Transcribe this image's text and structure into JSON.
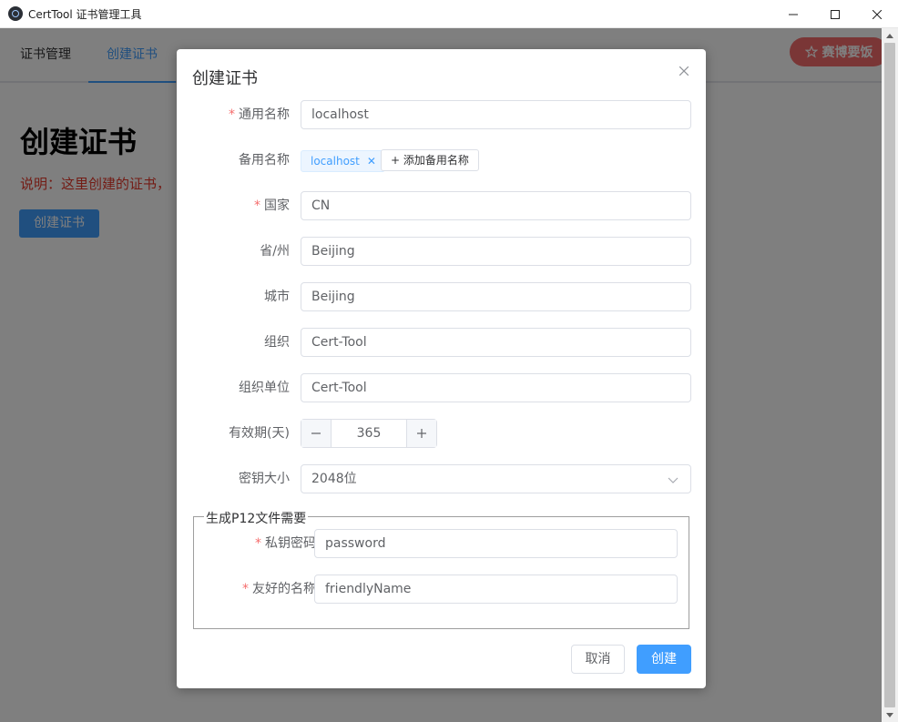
{
  "window": {
    "title": "CertTool 证书管理工具",
    "controls": [
      "minimize",
      "maximize",
      "close"
    ]
  },
  "tabs": [
    {
      "label": "证书管理",
      "active": false
    },
    {
      "label": "创建证书",
      "active": true
    }
  ],
  "sponsor_label": "赛博要饭",
  "page": {
    "heading": "创建证书",
    "description": "说明：这里创建的证书，",
    "create_button": "创建证书"
  },
  "dialog": {
    "title": "创建证书",
    "fields": {
      "common_name": {
        "label": "通用名称",
        "required": true,
        "value": "localhost"
      },
      "alt_names": {
        "label": "备用名称",
        "tags": [
          "localhost"
        ],
        "add_label": "+ 添加备用名称"
      },
      "country": {
        "label": "国家",
        "required": true,
        "value": "CN"
      },
      "province": {
        "label": "省/州",
        "value": "Beijing"
      },
      "city": {
        "label": "城市",
        "value": "Beijing"
      },
      "org": {
        "label": "组织",
        "value": "Cert-Tool"
      },
      "org_unit": {
        "label": "组织单位",
        "value": "Cert-Tool"
      },
      "validity": {
        "label": "有效期(天)",
        "value": "365"
      },
      "key_size": {
        "label": "密钥大小",
        "value": "2048位"
      }
    },
    "p12": {
      "legend": "生成P12文件需要",
      "password": {
        "label": "私钥密码",
        "required": true,
        "value": "password"
      },
      "friendly_name": {
        "label": "友好的名称",
        "required": true,
        "value": "friendlyName"
      }
    },
    "cancel_label": "取消",
    "ok_label": "创建"
  },
  "colors": {
    "primary": "#409eff",
    "danger": "#f56c6c",
    "text": "#303133"
  }
}
